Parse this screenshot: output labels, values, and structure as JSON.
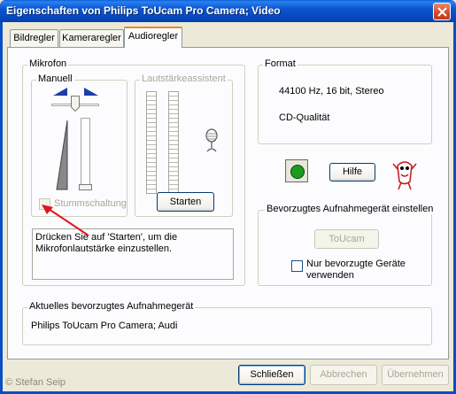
{
  "window": {
    "title": "Eigenschaften von Philips ToUcam Pro Camera; Video"
  },
  "tabs": [
    {
      "label": "Bildregler"
    },
    {
      "label": "Kameraregler"
    },
    {
      "label": "Audioregler"
    }
  ],
  "mikrofon": {
    "group_label": "Mikrofon",
    "manuell": {
      "group_label": "Manuell",
      "mute_label": "Stummschaltung",
      "mute_checked": false
    },
    "assistant": {
      "group_label": "Lautstärkeassistent",
      "start_button": "Starten"
    },
    "hint_text": "Drücken Sie auf 'Starten', um die Mikrofonlautstärke einzustellen."
  },
  "format": {
    "group_label": "Format",
    "line1": "44100 Hz, 16 bit, Stereo",
    "line2": "CD-Qualität"
  },
  "status_color": "#1e9a1e",
  "help_button": "Hilfe",
  "preferred": {
    "group_label": "Bevorzugtes Aufnahmegerät einstellen",
    "device_button": "ToUcam",
    "only_preferred_label": "Nur bevorzugte Geräte verwenden",
    "only_preferred_checked": false
  },
  "current_device": {
    "group_label": "Aktuelles bevorzugtes Aufnahmegerät",
    "value": "Philips ToUcam Pro Camera; Audi"
  },
  "footer": {
    "close_button": "Schließen",
    "cancel_button": "Abbrechen",
    "apply_button": "Übernehmen"
  },
  "watermark": "© Stefan Seip",
  "annotation_color": "#e0141e"
}
